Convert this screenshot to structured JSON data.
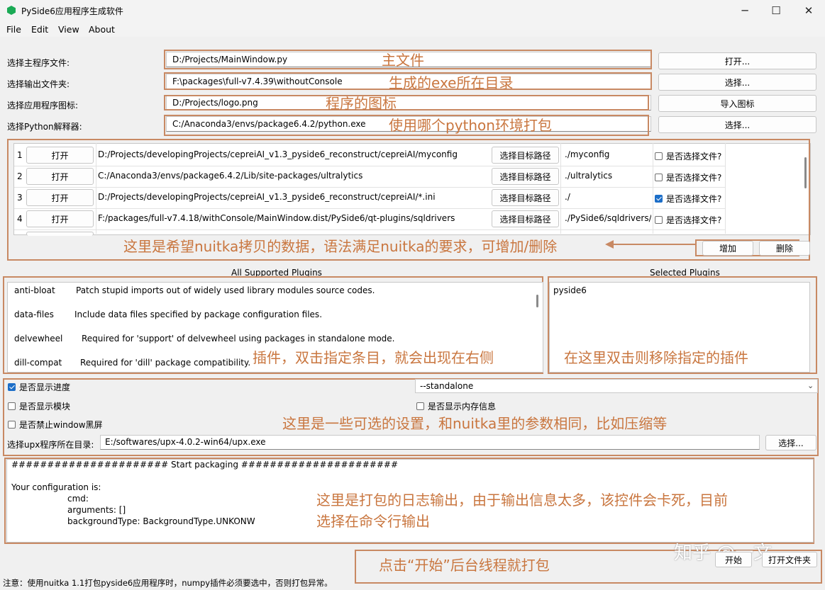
{
  "window": {
    "title": "PySide6应用程序生成软件",
    "minimize_glyph": "─",
    "maximize_glyph": "☐",
    "close_glyph": "✕"
  },
  "menu": [
    "File",
    "Edit",
    "View",
    "About"
  ],
  "form": {
    "main_file": {
      "label": "选择主程序文件:",
      "value": "D:/Projects/MainWindow.py",
      "button": "打开..."
    },
    "output_dir": {
      "label": "选择输出文件夹:",
      "value": "F:\\packages\\full-v7.4.39\\withoutConsole",
      "button": "选择..."
    },
    "icon": {
      "label": "选择应用程序图标:",
      "value": "D:/Projects/logo.png",
      "button": "导入图标"
    },
    "python": {
      "label": "选择Python解释器:",
      "value": "C:/Anaconda3/envs/package6.4.2/python.exe",
      "button": "选择..."
    }
  },
  "data_table": {
    "rows": [
      {
        "index": "1",
        "open": "打开",
        "source": "D:/Projects/developingProjects/cepreiAI_v1.3_pyside6_reconstruct/cepreiAI/myconfig",
        "pick": "选择目标路径",
        "target": "./myconfig",
        "is_file_label": "是否选择文件?",
        "is_file": false
      },
      {
        "index": "2",
        "open": "打开",
        "source": "C:/Anaconda3/envs/package6.4.2/Lib/site-packages/ultralytics",
        "pick": "选择目标路径",
        "target": "./ultralytics",
        "is_file_label": "是否选择文件?",
        "is_file": false
      },
      {
        "index": "3",
        "open": "打开",
        "source": "D:/Projects/developingProjects/cepreiAI_v1.3_pyside6_reconstruct/cepreiAI/*.ini",
        "pick": "选择目标路径",
        "target": "./",
        "is_file_label": "是否选择文件?",
        "is_file": true
      },
      {
        "index": "4",
        "open": "打开",
        "source": "F:/packages/full-v7.4.18/withConsole/MainWindow.dist/PySide6/qt-plugins/sqldrivers",
        "pick": "选择目标路径",
        "target": "./PySide6/sqldrivers/",
        "is_file_label": "是否选择文件?",
        "is_file": false
      }
    ],
    "add_button": "增加",
    "delete_button": "删除"
  },
  "plugins": {
    "all_title": "All Supported Plugins",
    "selected_title": "Selected Plugins",
    "all": [
      {
        "name": "anti-bloat",
        "desc": "Patch stupid imports out of widely used library modules source codes."
      },
      {
        "name": "data-files",
        "desc": "Include data files specified by package configuration files."
      },
      {
        "name": "delvewheel",
        "desc": "Required for 'support' of delvewheel using packages in standalone mode."
      },
      {
        "name": "dill-compat",
        "desc": "Required for 'dill' package compatibility."
      }
    ],
    "selected": [
      "pyside6"
    ]
  },
  "options": {
    "show_progress": {
      "label": "是否显示进度",
      "checked": true
    },
    "show_modules": {
      "label": "是否显示模块",
      "checked": false
    },
    "disable_console": {
      "label": "是否禁止window黑屏",
      "checked": false
    },
    "show_memory": {
      "label": "是否显示内存信息",
      "checked": false
    },
    "mode": "--standalone",
    "upx": {
      "label": "选择upx程序所在目录:",
      "value": "E:/softwares/upx-4.0.2-win64/upx.exe",
      "button": "选择..."
    }
  },
  "log": {
    "lines": [
      "###################### Start packaging ######################",
      "",
      "Your configuration is:",
      "cmd:",
      "arguments: []",
      "backgroundType: BackgroundType.UNKONW"
    ]
  },
  "actions": {
    "start": "开始",
    "open_folder": "打开文件夹"
  },
  "status_bar": "注意：使用nuitka 1.1打包pyside6应用程序时，numpy插件必须要选中，否则打包异常。",
  "annotations": {
    "main_file": "主文件",
    "output_dir": "生成的exe所在目录",
    "icon": "程序的图标",
    "python": "使用哪个python环境打包",
    "data": "这里是希望nuitka拷贝的数据，语法满足nuitka的要求，可增加/删除",
    "plugins_left": "插件，双击指定条目，就会出现在右侧",
    "plugins_right": "在这里双击则移除指定的插件",
    "options": "这里是一些可选的设置，和nuitka里的参数相同，比如压缩等",
    "log_1": "这里是打包的日志输出，由于输出信息太多，该控件会卡死，目前",
    "log_2": "选择在命令行输出",
    "start": "点击“开始”后台线程就打包",
    "watermark": "知乎 @一文"
  },
  "colors": {
    "annotation": "#c9763f",
    "annotation_border": "#c88963",
    "check_accent": "#1c6ec8",
    "icon_green": "#1aaa55"
  }
}
